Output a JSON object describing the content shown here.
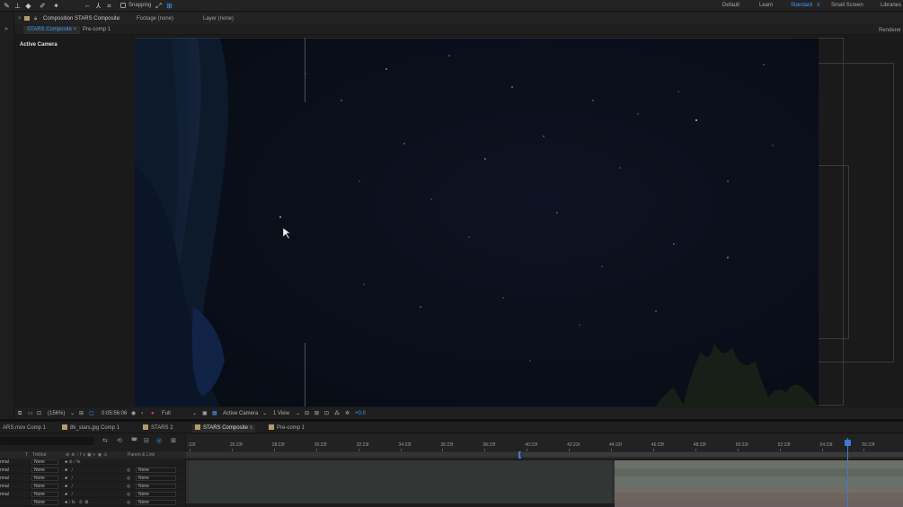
{
  "workspaces": {
    "items": [
      "Default",
      "Learn",
      "Standard",
      "Small Screen",
      "Libraries"
    ],
    "active": "Standard"
  },
  "toolbar": {
    "snapping_label": "Snapping"
  },
  "panel_header": {
    "composition": "Composition STARS Composite",
    "footage": "Footage (none)",
    "layer": "Layer (none)"
  },
  "comp_tabs": [
    "STARS Composite",
    "Pre-comp 1"
  ],
  "renderer_label": "Renderer",
  "viewer": {
    "active_camera_label": "Active Camera"
  },
  "viewer_controls": {
    "magnification": "(156%)",
    "timecode": "0:05:56:06",
    "resolution": "Full",
    "camera": "Active Camera",
    "views": "1 View",
    "exposure": "+0.0"
  },
  "timeline_tabs": [
    "ARS.mov Comp 1",
    "8k_stars.jpg Comp 1",
    "STARS 2",
    "STARS Composite",
    "Pre-comp 1"
  ],
  "timeline_tab_active": "STARS Composite",
  "layer_columns": {
    "trkmat": "TrkMat",
    "parent": "Parent & Link"
  },
  "layers": [
    {
      "mode": "rmal",
      "trkmat": "None",
      "parent": "None"
    },
    {
      "mode": "rmal",
      "trkmat": "None",
      "parent": "None"
    },
    {
      "mode": "rmal",
      "trkmat": "None",
      "parent": "None"
    },
    {
      "mode": "rmal",
      "trkmat": "None",
      "parent": "None"
    },
    {
      "mode": "rmal",
      "trkmat": "None",
      "parent": "None"
    },
    {
      "mode": "",
      "trkmat": "None",
      "parent": "None"
    }
  ],
  "ruler_ticks": [
    ":23f",
    "26:23f",
    "28:23f",
    "30:23f",
    "32:23f",
    "34:23f",
    "36:23f",
    "38:23f",
    "40:23f",
    "42:23f",
    "44:23f",
    "46:23f",
    "48:23f",
    "50:23f",
    "52:23f",
    "54:23f",
    "56:23f",
    "58"
  ],
  "colors": {
    "accent_blue": "#3d9bff",
    "playhead": "#3d7ad8",
    "label_tan": "#b89a6a",
    "sky": "#0a0f1a"
  },
  "icons": [
    "pen-tool-icon",
    "stamp-tool-icon",
    "eraser-tool-icon",
    "roto-brush-icon",
    "puppet-pin-icon",
    "axis-tools-icon",
    "snapping-icon",
    "expand-panel-icon",
    "camera-snapshot-icon",
    "graph-editor-icon"
  ]
}
